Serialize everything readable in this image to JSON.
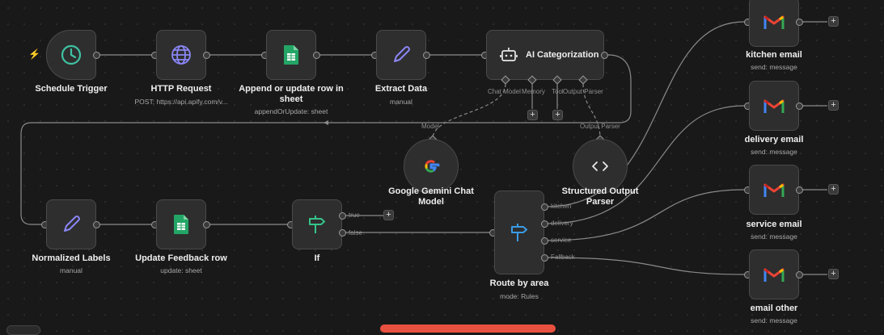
{
  "nodes": {
    "schedule": {
      "title": "Schedule Trigger"
    },
    "http": {
      "title": "HTTP Request",
      "sub": "POST: https://api.apify.com/v..."
    },
    "append": {
      "title": "Append or update row in sheet",
      "sub": "appendOrUpdate: sheet"
    },
    "extract": {
      "title": "Extract Data",
      "sub": "manual"
    },
    "ai": {
      "title": "AI Categorization",
      "port_chat": "Chat Model",
      "port_memory": "Memory",
      "port_tool": "Tool",
      "port_parser": "Output Parser"
    },
    "gemini": {
      "title": "Google Gemini Chat Model",
      "edge_label": "Model"
    },
    "parser": {
      "title": "Structured Output Parser",
      "edge_label": "Output Parser"
    },
    "normalized": {
      "title": "Normalized Labels",
      "sub": "manual"
    },
    "feedback": {
      "title": "Update Feedback row",
      "sub": "update: sheet"
    },
    "if": {
      "title": "If",
      "out_true": "true",
      "out_false": "false"
    },
    "route": {
      "title": "Route by area",
      "sub": "mode: Rules",
      "out_kitchen": "kitchen",
      "out_delivery": "delivery",
      "out_service": "service",
      "out_fallback": "Fallback"
    },
    "kitchen_email": {
      "title": "kitchen email",
      "sub": "send: message"
    },
    "delivery_email": {
      "title": "delivery email",
      "sub": "send: message"
    },
    "service_email": {
      "title": "service email",
      "sub": "send: message"
    },
    "email_other": {
      "title": "email other",
      "sub": "send: message"
    }
  },
  "plus_symbol": "+",
  "colors": {
    "background": "#191919",
    "node": "#2e2e2e",
    "edge": "#8a8a8a",
    "accent_red": "#e8513f",
    "clock": "#3fc2a3",
    "globe": "#8a86f5",
    "sheets": "#23a566",
    "pen": "#8a86f5",
    "router": "#3a9be6",
    "if": "#35c48a"
  },
  "icons": [
    "bolt-icon",
    "clock-icon",
    "globe-icon",
    "sheets-icon",
    "pen-icon",
    "robot-icon",
    "google-icon",
    "code-icon",
    "if-icon",
    "router-icon",
    "gmail-icon"
  ]
}
